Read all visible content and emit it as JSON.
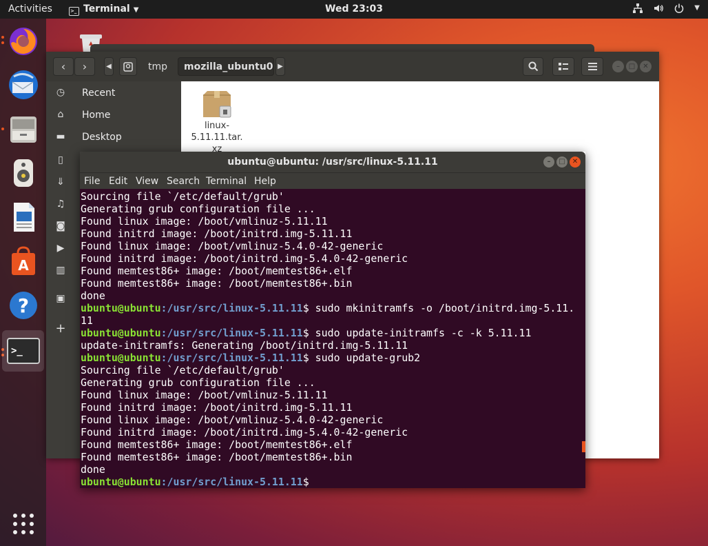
{
  "topbar": {
    "activities": "Activities",
    "app_menu": "Terminal",
    "clock": "Wed 23:03"
  },
  "dock": {
    "apps": [
      "firefox-icon",
      "thunderbird-icon",
      "files-icon",
      "rhythmbox-icon",
      "writer-icon",
      "software-icon",
      "help-icon",
      "terminal-icon",
      "app-grid-icon"
    ]
  },
  "files": {
    "breadcrumbs": [
      "tmp",
      "mozilla_ubuntu0"
    ],
    "sidebar": [
      {
        "label": "Recent",
        "icon": "clock-icon"
      },
      {
        "label": "Home",
        "icon": "home-icon"
      },
      {
        "label": "Desktop",
        "icon": "folder-icon"
      }
    ],
    "item": {
      "name": "linux-5.11.11.tar.xz",
      "name_lines": [
        "linux-",
        "5.11.11.tar.",
        "xz"
      ]
    }
  },
  "terminal": {
    "title": "ubuntu@ubuntu: /usr/src/linux-5.11.11",
    "menu": [
      "File",
      "Edit",
      "View",
      "Search",
      "Terminal",
      "Help"
    ],
    "prompt_user": "ubuntu@ubuntu",
    "prompt_path": ":/usr/src/linux-5.11.11",
    "lines": [
      {
        "t": "Sourcing file `/etc/default/grub'"
      },
      {
        "t": "Generating grub configuration file ..."
      },
      {
        "t": "Found linux image: /boot/vmlinuz-5.11.11"
      },
      {
        "t": "Found initrd image: /boot/initrd.img-5.11.11"
      },
      {
        "t": "Found linux image: /boot/vmlinuz-5.4.0-42-generic"
      },
      {
        "t": "Found initrd image: /boot/initrd.img-5.4.0-42-generic"
      },
      {
        "t": "Found memtest86+ image: /boot/memtest86+.elf"
      },
      {
        "t": "Found memtest86+ image: /boot/memtest86+.bin"
      },
      {
        "t": "done"
      },
      {
        "p": true,
        "t": "$ sudo mkinitramfs -o /boot/initrd.img-5.11."
      },
      {
        "t": "11"
      },
      {
        "p": true,
        "t": "$ sudo update-initramfs -c -k 5.11.11"
      },
      {
        "t": "update-initramfs: Generating /boot/initrd.img-5.11.11"
      },
      {
        "p": true,
        "t": "$ sudo update-grub2"
      },
      {
        "t": "Sourcing file `/etc/default/grub'"
      },
      {
        "t": "Generating grub configuration file ..."
      },
      {
        "t": "Found linux image: /boot/vmlinuz-5.11.11"
      },
      {
        "t": "Found initrd image: /boot/initrd.img-5.11.11"
      },
      {
        "t": "Found linux image: /boot/vmlinuz-5.4.0-42-generic"
      },
      {
        "t": "Found initrd image: /boot/initrd.img-5.4.0-42-generic"
      },
      {
        "t": "Found memtest86+ image: /boot/memtest86+.elf"
      },
      {
        "t": "Found memtest86+ image: /boot/memtest86+.bin"
      },
      {
        "t": "done"
      },
      {
        "p": true,
        "t": "$"
      }
    ]
  },
  "colors": {
    "accent": "#e95420",
    "terminal_bg": "#300a24",
    "prompt_user": "#8ae234",
    "prompt_path": "#729fcf"
  }
}
